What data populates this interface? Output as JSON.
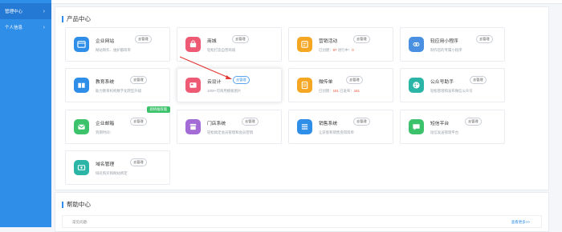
{
  "sidebar": {
    "items": [
      {
        "label": "管理中心",
        "chevron": "›"
      },
      {
        "label": "个人信息",
        "chevron": "›"
      }
    ]
  },
  "products": {
    "title": "产品中心",
    "cards": [
      {
        "title": "企业网站",
        "badge": "去管理",
        "desc": "网站制作、维护都简单",
        "icon": "browser-icon",
        "color": "#2f8ee8"
      },
      {
        "title": "商城",
        "badge": "去管理",
        "desc": "轻松打造自营商城",
        "icon": "shop-bag-icon",
        "color": "#ee5a74"
      },
      {
        "title": "营销活动",
        "badge": "去管理",
        "desc_prefix": "已创建：",
        "desc_num1": "97",
        "desc_mid": "  进行中：",
        "desc_num2": "0",
        "icon": "marketing-icon",
        "color": "#f5a623"
      },
      {
        "title": "轻应用小程序",
        "badge": "去管理",
        "desc": "制作您的专属小程序",
        "icon": "mini-program-icon",
        "color": "#4a90e2"
      },
      {
        "title": "教育系统",
        "badge": "去管理",
        "desc": "助力教育机构数字化转型升级",
        "icon": "book-icon",
        "color": "#2f8ee8"
      },
      {
        "title": "云设计",
        "badge": "去管理",
        "desc": "10W+可商用模板图片",
        "icon": "design-icon",
        "color": "#ee5a74"
      },
      {
        "title": "微传单",
        "badge": "去管理",
        "desc_prefix": "已创建：",
        "desc_num1": "181",
        "desc_mid": "  已发布：",
        "desc_num2": "181",
        "icon": "flyer-icon",
        "color": "#f5a623"
      },
      {
        "title": "公众号助手",
        "badge": "去管理",
        "desc": "轻松管理和发布微信公众号",
        "icon": "palette-icon",
        "color": "#2bb5a6"
      },
      {
        "title": "企业邮箱",
        "badge": "去管理",
        "desc": "到期时间：",
        "corner": "即将推荐版",
        "icon": "mail-icon",
        "color": "#3cc26b"
      },
      {
        "title": "门店系统",
        "badge": "去管理",
        "desc": "轻松搞定会员管理和会员营销",
        "icon": "store-icon",
        "color": "#a26bd6"
      },
      {
        "title": "销售系统",
        "badge": "去管理",
        "desc": "让获客和销售变得简单",
        "icon": "list-icon",
        "color": "#2f8ee8"
      },
      {
        "title": "短信平台",
        "badge": "去管理",
        "desc": "短信发送管理平台",
        "icon": "message-icon",
        "color": "#3cc26b"
      },
      {
        "title": "域名管理",
        "badge": "去管理",
        "desc": "域名购买和网站绑定",
        "icon": "domain-icon",
        "color": "#2bb5a6"
      }
    ]
  },
  "help": {
    "title": "帮助中心",
    "question": "常见问题:",
    "more": "查看更多>>"
  },
  "colors": {
    "accent": "#2f8ee8",
    "arrow": "#e53935"
  }
}
